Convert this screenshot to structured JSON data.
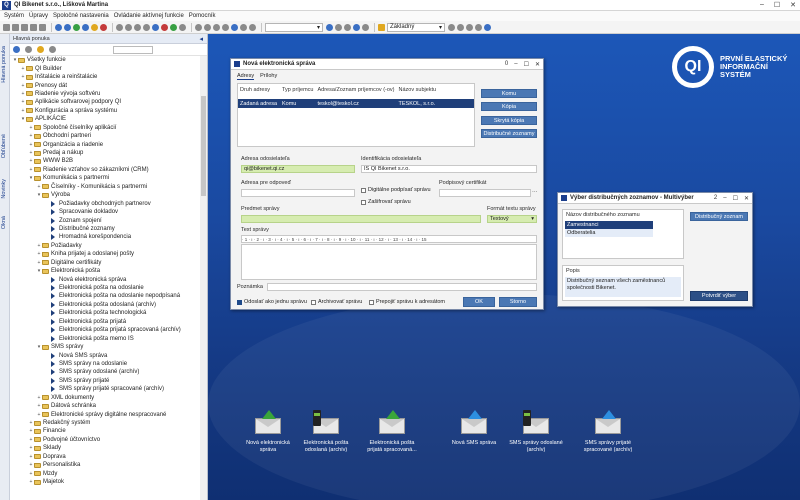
{
  "app": {
    "title": "QI  Bikenet s.r.o., Lišková Martina"
  },
  "menu": [
    "Systém",
    "Úpravy",
    "Spoločné nastavenia",
    "Ovládanie aktívnej funkcie",
    "Pomocník"
  ],
  "toolbar": {
    "profile": "Základný"
  },
  "vtabs": [
    "Hlavná ponuka",
    "Obľúbené",
    "Novinky",
    "Okná"
  ],
  "nav": {
    "header": "Hlavná ponuka",
    "tree": [
      {
        "level": 0,
        "type": "folder",
        "exp": "▾",
        "label": "Všetky funkcie"
      },
      {
        "level": 1,
        "type": "folder",
        "exp": "+",
        "label": "QI Builder"
      },
      {
        "level": 1,
        "type": "folder",
        "exp": "+",
        "label": "Inštalácie a reinštalácie"
      },
      {
        "level": 1,
        "type": "folder",
        "exp": "+",
        "label": "Prenosy dát"
      },
      {
        "level": 1,
        "type": "folder",
        "exp": "+",
        "label": "Riadenie vývoja softvéru"
      },
      {
        "level": 1,
        "type": "folder",
        "exp": "+",
        "label": "Aplikácie softvarovej podpory QI"
      },
      {
        "level": 1,
        "type": "folder",
        "exp": "+",
        "label": "Konfigurácia a správa systému"
      },
      {
        "level": 1,
        "type": "folder",
        "exp": "▾",
        "label": "APLIKÁCIE"
      },
      {
        "level": 2,
        "type": "folder",
        "exp": "+",
        "label": "Spoločné číselníky aplikácií"
      },
      {
        "level": 2,
        "type": "folder",
        "exp": "+",
        "label": "Obchodní partneri"
      },
      {
        "level": 2,
        "type": "folder",
        "exp": "+",
        "label": "Organizácia a riadenie"
      },
      {
        "level": 2,
        "type": "folder",
        "exp": "+",
        "label": "Predaj a nákup"
      },
      {
        "level": 2,
        "type": "folder",
        "exp": "+",
        "label": "WWW B2B"
      },
      {
        "level": 2,
        "type": "folder",
        "exp": "+",
        "label": "Riadenie vzťahov so zákazníkmi (CRM)"
      },
      {
        "level": 2,
        "type": "folder",
        "exp": "▾",
        "label": "Komunikácia s partnermi"
      },
      {
        "level": 3,
        "type": "folder",
        "exp": "+",
        "label": "Číselníky - Komunikácia s partnermi"
      },
      {
        "level": 3,
        "type": "folder",
        "exp": "▾",
        "label": "Výroba"
      },
      {
        "level": 4,
        "type": "doc",
        "exp": "",
        "label": "Požiadavky obchodných partnerov"
      },
      {
        "level": 4,
        "type": "doc",
        "exp": "",
        "label": "Spracovanie dokladov"
      },
      {
        "level": 4,
        "type": "doc",
        "exp": "",
        "label": "Zoznam spojení"
      },
      {
        "level": 4,
        "type": "doc",
        "exp": "",
        "label": "Distribučné zoznamy"
      },
      {
        "level": 4,
        "type": "doc",
        "exp": "",
        "label": "Hromadná korešpondencia"
      },
      {
        "level": 3,
        "type": "folder",
        "exp": "+",
        "label": "Požiadavky"
      },
      {
        "level": 3,
        "type": "folder",
        "exp": "+",
        "label": "Kniha prijatej a odoslanej pošty"
      },
      {
        "level": 3,
        "type": "folder",
        "exp": "+",
        "label": "Digitálne certifikáty"
      },
      {
        "level": 3,
        "type": "folder",
        "exp": "▾",
        "label": "Elektronická pošta"
      },
      {
        "level": 4,
        "type": "doc",
        "exp": "",
        "label": "Nová elektronická správa"
      },
      {
        "level": 4,
        "type": "doc",
        "exp": "",
        "label": "Elektronická pošta na odoslanie"
      },
      {
        "level": 4,
        "type": "doc",
        "exp": "",
        "label": "Elektronická pošta na odoslanie nepodpísaná"
      },
      {
        "level": 4,
        "type": "doc",
        "exp": "",
        "label": "Elektronická pošta odoslaná (archív)"
      },
      {
        "level": 4,
        "type": "doc",
        "exp": "",
        "label": "Elektronická pošta technologická"
      },
      {
        "level": 4,
        "type": "doc",
        "exp": "",
        "label": "Elektronická pošta prijatá"
      },
      {
        "level": 4,
        "type": "doc",
        "exp": "",
        "label": "Elektronická pošta prijatá spracovaná (archív)"
      },
      {
        "level": 4,
        "type": "doc",
        "exp": "",
        "label": "Elektronická pošta memo IS"
      },
      {
        "level": 3,
        "type": "folder",
        "exp": "▾",
        "label": "SMS správy"
      },
      {
        "level": 4,
        "type": "doc",
        "exp": "",
        "label": "Nová SMS správa"
      },
      {
        "level": 4,
        "type": "doc",
        "exp": "",
        "label": "SMS správy na odoslanie"
      },
      {
        "level": 4,
        "type": "doc",
        "exp": "",
        "label": "SMS správy odoslané (archív)"
      },
      {
        "level": 4,
        "type": "doc",
        "exp": "",
        "label": "SMS správy prijaté"
      },
      {
        "level": 4,
        "type": "doc",
        "exp": "",
        "label": "SMS správy prijaté spracované (archív)"
      },
      {
        "level": 3,
        "type": "folder",
        "exp": "+",
        "label": "XML dokumenty"
      },
      {
        "level": 3,
        "type": "folder",
        "exp": "+",
        "label": "Dátová schránka"
      },
      {
        "level": 3,
        "type": "folder",
        "exp": "+",
        "label": "Elektronické správy digitálne nespracované"
      },
      {
        "level": 2,
        "type": "folder",
        "exp": "+",
        "label": "Redakčný systém"
      },
      {
        "level": 2,
        "type": "folder",
        "exp": "+",
        "label": "Financie"
      },
      {
        "level": 2,
        "type": "folder",
        "exp": "+",
        "label": "Podvojné účtovníctvo"
      },
      {
        "level": 2,
        "type": "folder",
        "exp": "+",
        "label": "Sklady"
      },
      {
        "level": 2,
        "type": "folder",
        "exp": "+",
        "label": "Doprava"
      },
      {
        "level": 2,
        "type": "folder",
        "exp": "+",
        "label": "Personalistika"
      },
      {
        "level": 2,
        "type": "folder",
        "exp": "+",
        "label": "Mzdy"
      },
      {
        "level": 2,
        "type": "folder",
        "exp": "+",
        "label": "Majetok"
      }
    ]
  },
  "logo": {
    "line1": "PRVNÍ ELASTICKÝ",
    "line2": "INFORMAČNÍ",
    "line3": "SYSTÉM",
    "mark": "QI"
  },
  "email": {
    "title": "Nová elektronická správa",
    "ctl_num": "0",
    "tabs": [
      "Adresy",
      "Prílohy"
    ],
    "grid_headers": [
      "Druh adresy",
      "Typ príjemcu",
      "Adresa/Zoznam príjemcov (-ov)",
      "Názov subjektu"
    ],
    "grid_row": [
      "Zadaná adresa",
      "Komu",
      "teskol@teskol.cz",
      "TESKOL, s.r.o."
    ],
    "buttons": {
      "to": "Komu",
      "cc": "Kópia",
      "bcc": "Skrytá kópia",
      "dist": "Distribučné zoznamy",
      "ok": "OK",
      "cancel": "Storno"
    },
    "sender_label": "Adresa odosielateľa",
    "sender_value": "qi@bikenet.qi.cz",
    "sender_id_label": "Identifikácia odosielateľa",
    "sender_id_value": "IS QI Bikenet s.r.o.",
    "reply_label": "Adresa pre odpoveď",
    "sign_label": "Digitálne podpísať správu",
    "encrypt_label": "Zašifrovať správu",
    "cert_label": "Podpisový certifikát",
    "subject_label": "Predmet správy",
    "format_label": "Formát textu správy",
    "format_value": "Textový",
    "body_label": "Text správy",
    "ruler_text": "· 1 · ı · 2 · ı · 3 · ı · 4 · ı · 5 · ı · 6 · ı · 7 · ı · 8 · ı · 9 · ı · 10 · ı · 11 · ı · 12 · ı · 13 · ı · 14 · ı · 15",
    "note_label": "Poznámka",
    "send_once_label": "Odoslať ako jednu správu",
    "archive_label": "Archivovať správu",
    "link_label": "Prepojiť správu k adresátom"
  },
  "dist": {
    "title": "Výber distribučných zoznamov - Multivýber",
    "ctl_num": "2",
    "list_label": "Názov distribučného zoznamu",
    "items": [
      "Zamestnanci",
      "Odberatelia"
    ],
    "btn_list": "Distribučný zoznam",
    "desc_label": "Popis",
    "desc_text": "Distribučný seznam všech zaměstnanců společnosti Bikenet.",
    "btn_confirm": "Potvrdiť výber"
  },
  "shortcuts": [
    {
      "label": "Nová elektronická správa",
      "arrow": "green"
    },
    {
      "label": "Elektronická pošta odoslaná (archív)",
      "arrow": "bin"
    },
    {
      "label": "Elektronická pošta prijatá spracovaná...",
      "arrow": "green"
    },
    {
      "label": "Nová SMS správa",
      "arrow": "blue"
    },
    {
      "label": "SMS správy odoslané (archív)",
      "arrow": "bin"
    },
    {
      "label": "SMS správy prijaté spracované (archív)",
      "arrow": "blue"
    }
  ]
}
